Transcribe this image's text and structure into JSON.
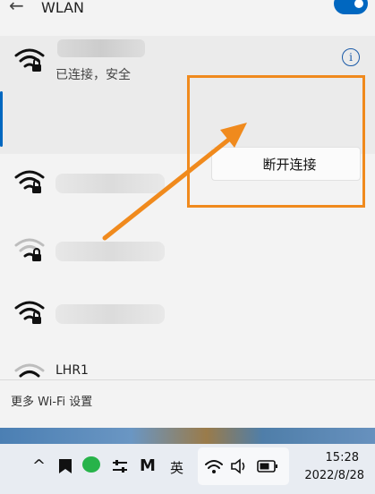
{
  "header": {
    "back_icon": "arrow-left-icon",
    "title": "WLAN",
    "toggle_state": "on"
  },
  "connected_network": {
    "status": "已连接，安全",
    "info_label": "i"
  },
  "context_menu": {
    "disconnect_label": "断开连接"
  },
  "networks": [
    {
      "name": "",
      "signal": "strong",
      "secured": true
    },
    {
      "name": "",
      "signal": "weak",
      "secured": true
    },
    {
      "name": "",
      "signal": "strong",
      "secured": true
    },
    {
      "name": "LHR1",
      "signal": "medium",
      "secured": false
    }
  ],
  "footer": {
    "more_settings_label": "更多 Wi-Fi 设置"
  },
  "taskbar": {
    "chevron_up": "^",
    "ime_label": "英",
    "time": "15:28",
    "date": "2022/8/28"
  },
  "colors": {
    "accent": "#0067c0",
    "highlight": "#f08a1d"
  }
}
